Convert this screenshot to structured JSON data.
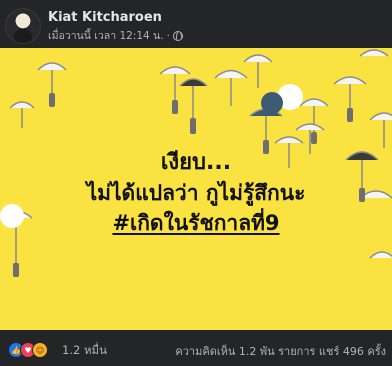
{
  "post": {
    "author": "Kiat Kitcharoen",
    "timestamp": "เมื่อวานนี้ เวลา 12:14 น.",
    "privacy_icon": "globe-icon"
  },
  "image": {
    "background": "#fae240",
    "line1": "เงียบ...",
    "line2": "ไม่ได้แปลว่า กูไม่รู้สึกนะ",
    "line3": "#เกิดในรัชกาลที่9"
  },
  "footer": {
    "reactions": [
      "like",
      "love",
      "haha"
    ],
    "reaction_count": "1.2 หมื่น",
    "stats": "ความคิดเห็น 1.2 พัน รายการ  แชร์ 496 ครั้ง"
  }
}
